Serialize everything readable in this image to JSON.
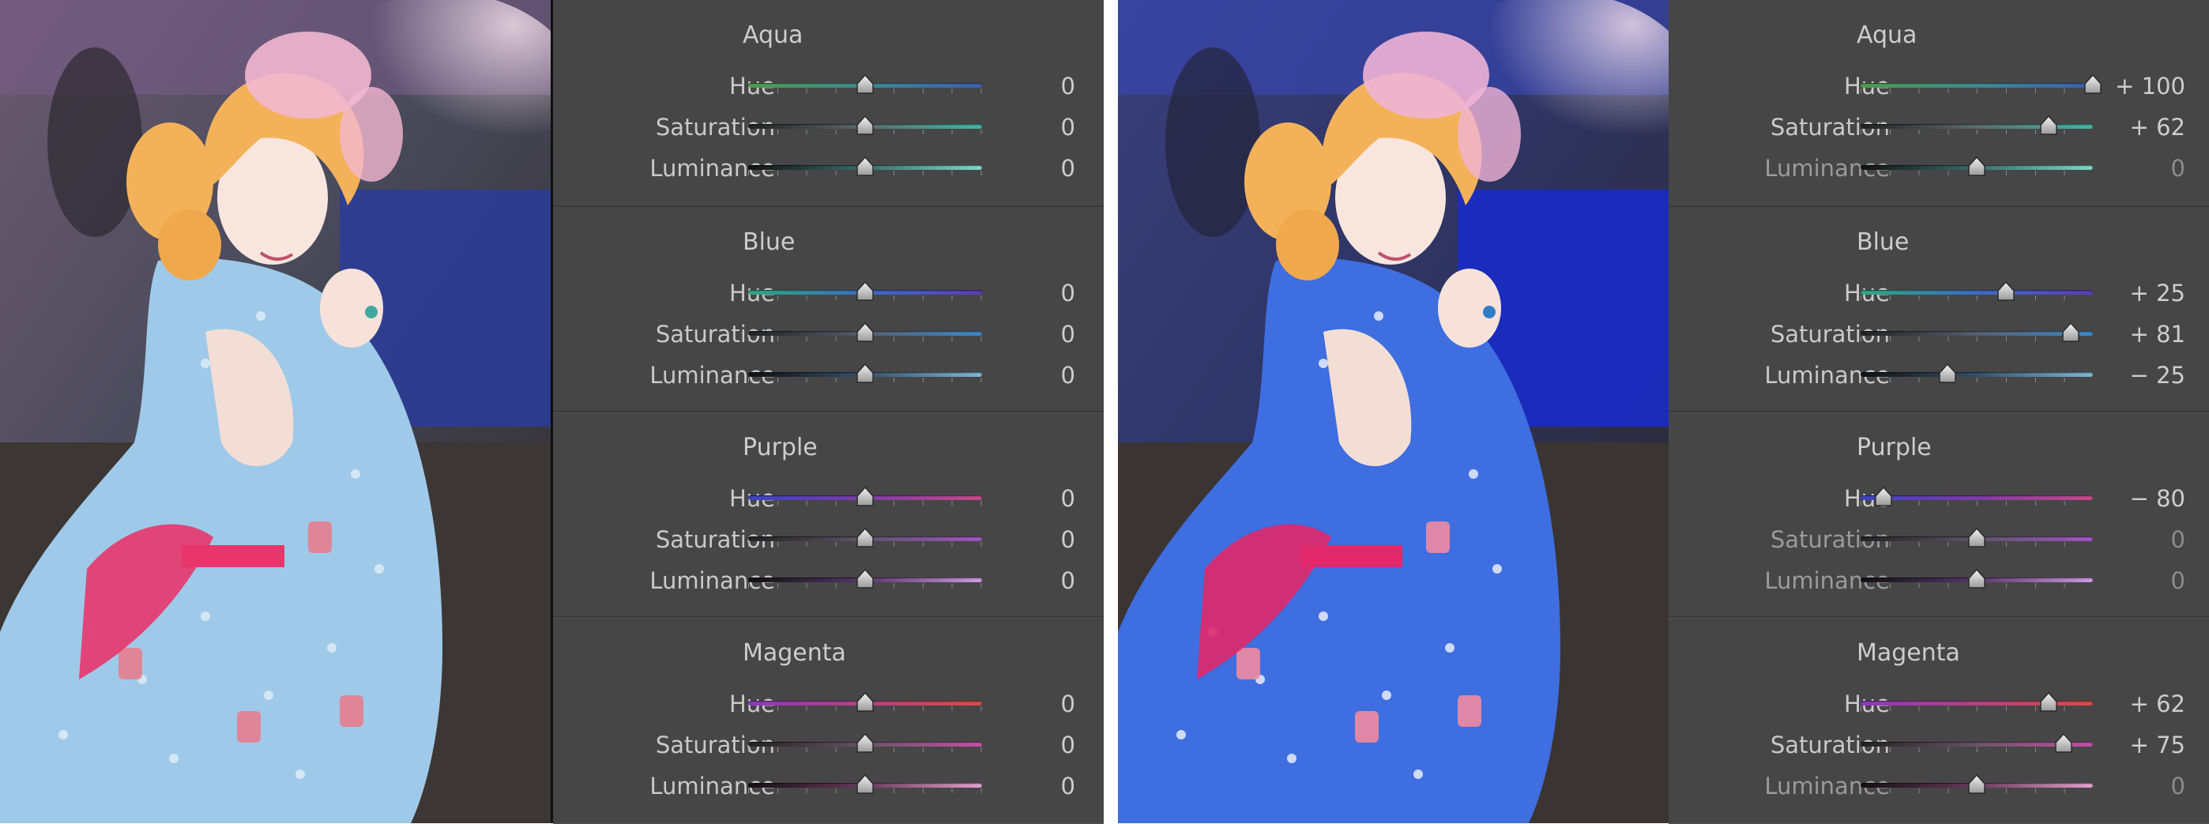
{
  "before": {
    "groups": [
      {
        "title": "Aqua",
        "rows": [
          {
            "label": "Hue",
            "value": "0",
            "pos": 0,
            "track": "#4f9a4c,#3f8a92,#3b5fb0"
          },
          {
            "label": "Saturation",
            "value": "0",
            "pos": 0,
            "track": "#222,#5b6b6a,#3fb6a4"
          },
          {
            "label": "Luminance",
            "value": "0",
            "pos": 0,
            "track": "#111,#3a6e68,#7fd7c8"
          }
        ]
      },
      {
        "title": "Blue",
        "rows": [
          {
            "label": "Hue",
            "value": "0",
            "pos": 0,
            "track": "#2fa77e,#3b6cc0,#5b3bb4"
          },
          {
            "label": "Saturation",
            "value": "0",
            "pos": 0,
            "track": "#222,#555f6f,#3f86c4"
          },
          {
            "label": "Luminance",
            "value": "0",
            "pos": 0,
            "track": "#111,#34506c,#7cb6d9"
          }
        ]
      },
      {
        "title": "Purple",
        "rows": [
          {
            "label": "Hue",
            "value": "0",
            "pos": 0,
            "track": "#3d44c4,#7b3ba6,#c64a88"
          },
          {
            "label": "Saturation",
            "value": "0",
            "pos": 0,
            "track": "#222,#5d556a,#9e55c0"
          },
          {
            "label": "Luminance",
            "value": "0",
            "pos": 0,
            "track": "#111,#56386a,#cf9ae0"
          }
        ]
      },
      {
        "title": "Magenta",
        "rows": [
          {
            "label": "Hue",
            "value": "0",
            "pos": 0,
            "track": "#8a3bc0,#b44080,#d84a46"
          },
          {
            "label": "Saturation",
            "value": "0",
            "pos": 0,
            "track": "#222,#6a5566,#c450a4"
          },
          {
            "label": "Luminance",
            "value": "0",
            "pos": 0,
            "track": "#111,#6b3a5c,#e2a0cc"
          }
        ]
      }
    ]
  },
  "after": {
    "groups": [
      {
        "title": "Aqua",
        "rows": [
          {
            "label": "Hue",
            "value": "+ 100",
            "pos": 100,
            "track": "#4f9a4c,#3f8a92,#3b5fb0"
          },
          {
            "label": "Saturation",
            "value": "+ 62",
            "pos": 62,
            "track": "#222,#5b6b6a,#3fb6a4"
          },
          {
            "label": "Luminance",
            "value": "0",
            "pos": 0,
            "muted": true,
            "track": "#111,#3a6e68,#7fd7c8"
          }
        ]
      },
      {
        "title": "Blue",
        "rows": [
          {
            "label": "Hue",
            "value": "+ 25",
            "pos": 25,
            "track": "#2fa77e,#3b6cc0,#5b3bb4"
          },
          {
            "label": "Saturation",
            "value": "+ 81",
            "pos": 81,
            "track": "#222,#555f6f,#3f86c4"
          },
          {
            "label": "Luminance",
            "value": "− 25",
            "pos": -25,
            "track": "#111,#34506c,#7cb6d9"
          }
        ]
      },
      {
        "title": "Purple",
        "rows": [
          {
            "label": "Hue",
            "value": "− 80",
            "pos": -80,
            "track": "#3d44c4,#7b3ba6,#c64a88"
          },
          {
            "label": "Saturation",
            "value": "0",
            "pos": 0,
            "muted": true,
            "track": "#222,#5d556a,#9e55c0"
          },
          {
            "label": "Luminance",
            "value": "0",
            "pos": 0,
            "muted": true,
            "track": "#111,#56386a,#cf9ae0"
          }
        ]
      },
      {
        "title": "Magenta",
        "rows": [
          {
            "label": "Hue",
            "value": "+ 62",
            "pos": 62,
            "track": "#8a3bc0,#b44080,#d84a46"
          },
          {
            "label": "Saturation",
            "value": "+ 75",
            "pos": 75,
            "track": "#222,#6a5566,#c450a4"
          },
          {
            "label": "Luminance",
            "value": "0",
            "pos": 0,
            "muted": true,
            "track": "#111,#6b3a5c,#e2a0cc"
          }
        ]
      }
    ]
  },
  "colors": {
    "panel_bg": "#464646",
    "label": "#c9c9c9",
    "value": "#cdcdcd",
    "muted": "#8c8c8c",
    "dress_before": "#9fc9e8",
    "dress_after": "#3e6ee0",
    "sash": "#e8356b",
    "hair": "#f3b25a"
  },
  "icons": {
    "photo_before": "cosplayer-photo-original",
    "photo_after": "cosplayer-photo-adjusted",
    "slider_thumb": "slider-thumb-icon"
  }
}
